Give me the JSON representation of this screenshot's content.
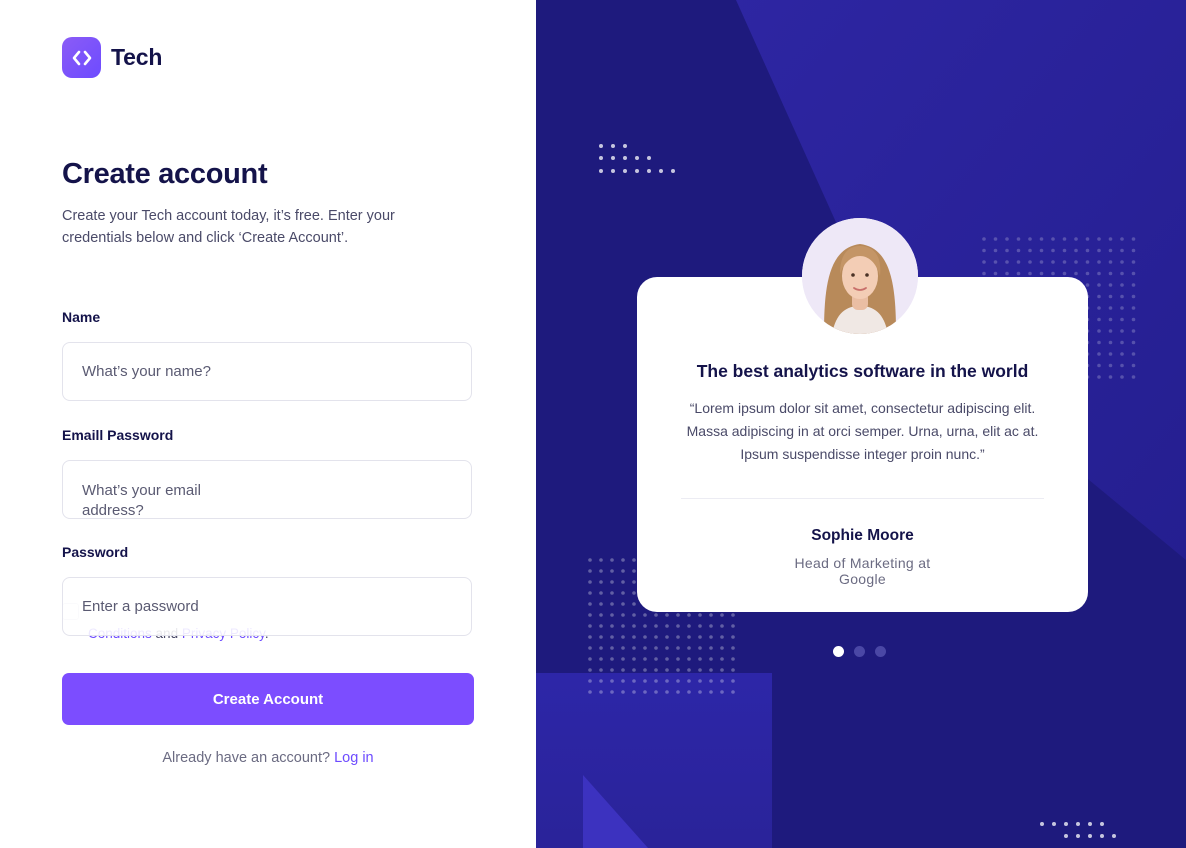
{
  "brand": {
    "name": "Tech",
    "logo_color": "#7c4dff"
  },
  "form": {
    "title": "Create account",
    "subtitle": "Create your Tech account today, it’s free. Enter your credentials below and click ‘Create Account’.",
    "name_label": "Name",
    "name_placeholder": "What’s your name?",
    "email_label": "Emaill Password",
    "email_placeholder": "What’s your email address?",
    "password_label": "Password",
    "password_placeholder": "Enter a password",
    "terms_link_1": "Conditions",
    "terms_and": " and ",
    "terms_link_2": "Privacy Policy",
    "terms_end": ".",
    "submit_label": "Create Account",
    "login_prompt": "Already have an account? ",
    "login_link": "Log in"
  },
  "testimonial": {
    "title": "The best analytics software in the world",
    "quote": "“Lorem ipsum dolor sit amet, consectetur adipiscing elit. Massa adipiscing in at orci semper. Urna, urna, elit ac at. Ipsum suspendisse integer proin nunc.”",
    "name": "Sophie Moore",
    "role": "Head of Marketing at Google",
    "slides_total": 3,
    "active_slide": 1
  },
  "colors": {
    "accent": "#7c4dff",
    "panel_bg": "#1e1a7d",
    "heading": "#14134a"
  }
}
